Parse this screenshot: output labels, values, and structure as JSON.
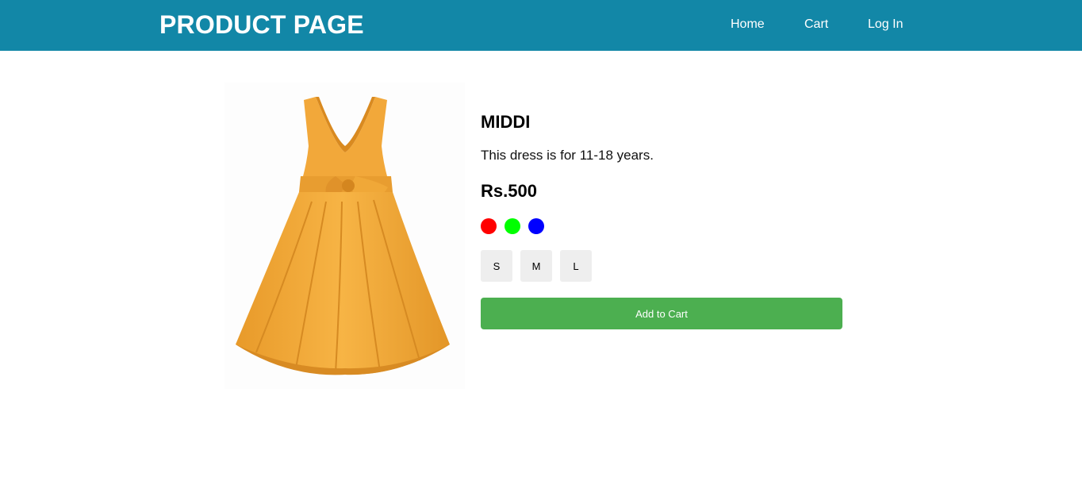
{
  "header": {
    "brand": "PRODUCT PAGE",
    "background": "#1287a7",
    "nav": [
      {
        "label": "Home"
      },
      {
        "label": "Cart"
      },
      {
        "label": "Log In"
      }
    ]
  },
  "product": {
    "image_alt": "orange-dress",
    "name": "MIDDI",
    "description": "This dress is for 11-18 years.",
    "price": "Rs.500",
    "colors": [
      {
        "name": "red",
        "hex": "#ff0000"
      },
      {
        "name": "green",
        "hex": "#00ff00"
      },
      {
        "name": "blue",
        "hex": "#0000ff"
      }
    ],
    "sizes": [
      "S",
      "M",
      "L"
    ],
    "add_to_cart_label": "Add to Cart",
    "add_to_cart_color": "#4caf50"
  }
}
